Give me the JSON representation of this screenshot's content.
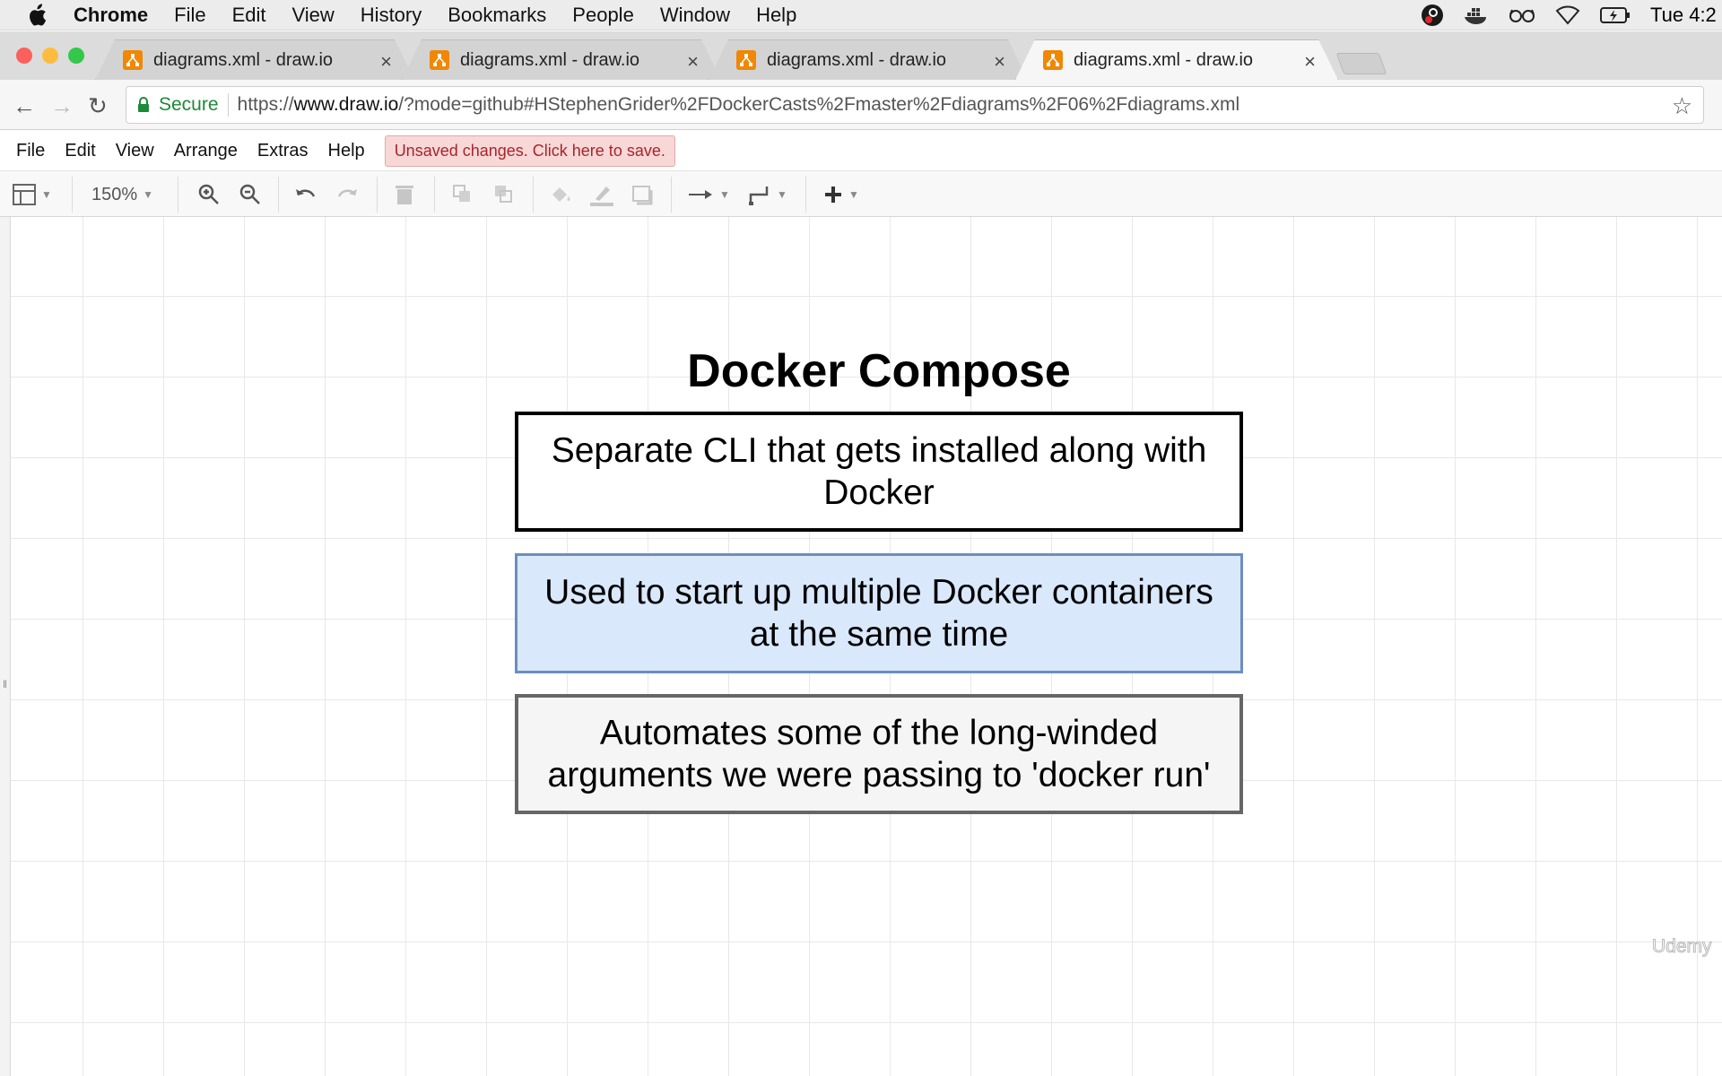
{
  "os_menubar": {
    "app_name": "Chrome",
    "items": [
      "File",
      "Edit",
      "View",
      "History",
      "Bookmarks",
      "People",
      "Window",
      "Help"
    ],
    "clock": "Tue 4:2",
    "status_icons": [
      "creative-cloud-icon",
      "docker-icon",
      "glasses-icon",
      "wifi-icon",
      "battery-charging-icon"
    ]
  },
  "browser": {
    "tabs": [
      {
        "title": "diagrams.xml - draw.io",
        "active": false
      },
      {
        "title": "diagrams.xml - draw.io",
        "active": false
      },
      {
        "title": "diagrams.xml - draw.io",
        "active": false
      },
      {
        "title": "diagrams.xml - draw.io",
        "active": true
      }
    ],
    "secure_label": "Secure",
    "url_prefix": "https://",
    "url_host": "www.draw.io",
    "url_path": "/?mode=github#HStephenGrider%2FDockerCasts%2Fmaster%2Fdiagrams%2F06%2Fdiagrams.xml"
  },
  "app_menu": {
    "items": [
      "File",
      "Edit",
      "View",
      "Arrange",
      "Extras",
      "Help"
    ],
    "unsaved_notice": "Unsaved changes. Click here to save."
  },
  "toolbar": {
    "zoom": "150%"
  },
  "diagram": {
    "title": "Docker Compose",
    "boxes": [
      {
        "text": "Separate CLI that gets installed along with Docker",
        "fill": "#ffffff",
        "stroke": "#000000"
      },
      {
        "text": "Used to start up multiple Docker containers at the same time",
        "fill": "#dae8fc",
        "stroke": "#6c8ebf"
      },
      {
        "text": "Automates some of the long-winded arguments we were passing to 'docker run'",
        "fill": "#f5f5f5",
        "stroke": "#666666"
      }
    ]
  },
  "watermark": "Udemy",
  "colors": {
    "unsaved_bg": "#f8d7d7",
    "unsaved_text": "#a6262a",
    "secure_green": "#1b8a3a",
    "drawio_orange": "#f08705"
  }
}
